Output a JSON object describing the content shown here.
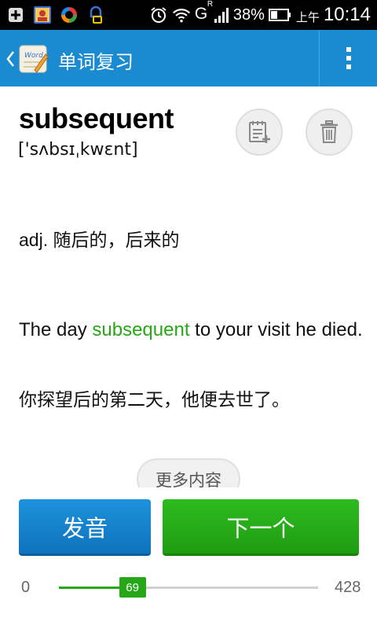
{
  "status_bar": {
    "signal_indicator": "G",
    "roaming_indicator": "R",
    "battery": "38%",
    "ampm": "上午",
    "time": "10:14",
    "icons": [
      "add-notification-icon",
      "contacts-app-icon",
      "sync-app-icon",
      "bluetooth-app-icon",
      "alarm-icon",
      "wifi-icon",
      "cell-signal-icon",
      "battery-icon"
    ]
  },
  "action_bar": {
    "title": "单词复习",
    "icons": [
      "back-chevron-icon",
      "app-logo-icon",
      "overflow-menu-icon"
    ]
  },
  "card": {
    "word": "subsequent",
    "phonetic": "['sʌbsɪˌkwɛnt]",
    "definition": "adj. 随后的，后来的",
    "example_before": "The day ",
    "example_highlight": "subsequent",
    "example_after": " to your visit he died.",
    "translation": "你探望后的第二天，他便去世了。",
    "more_label": "更多内容",
    "icons": [
      "add-note-icon",
      "trash-icon"
    ]
  },
  "buttons": {
    "pronounce": "发音",
    "next": "下一个"
  },
  "progress": {
    "min": "0",
    "current": "69",
    "max": "428"
  },
  "colors": {
    "action_bar": "#1b8bd1",
    "highlight_green": "#27a617",
    "button_blue": "#1583cf",
    "button_green": "#25ad17"
  }
}
